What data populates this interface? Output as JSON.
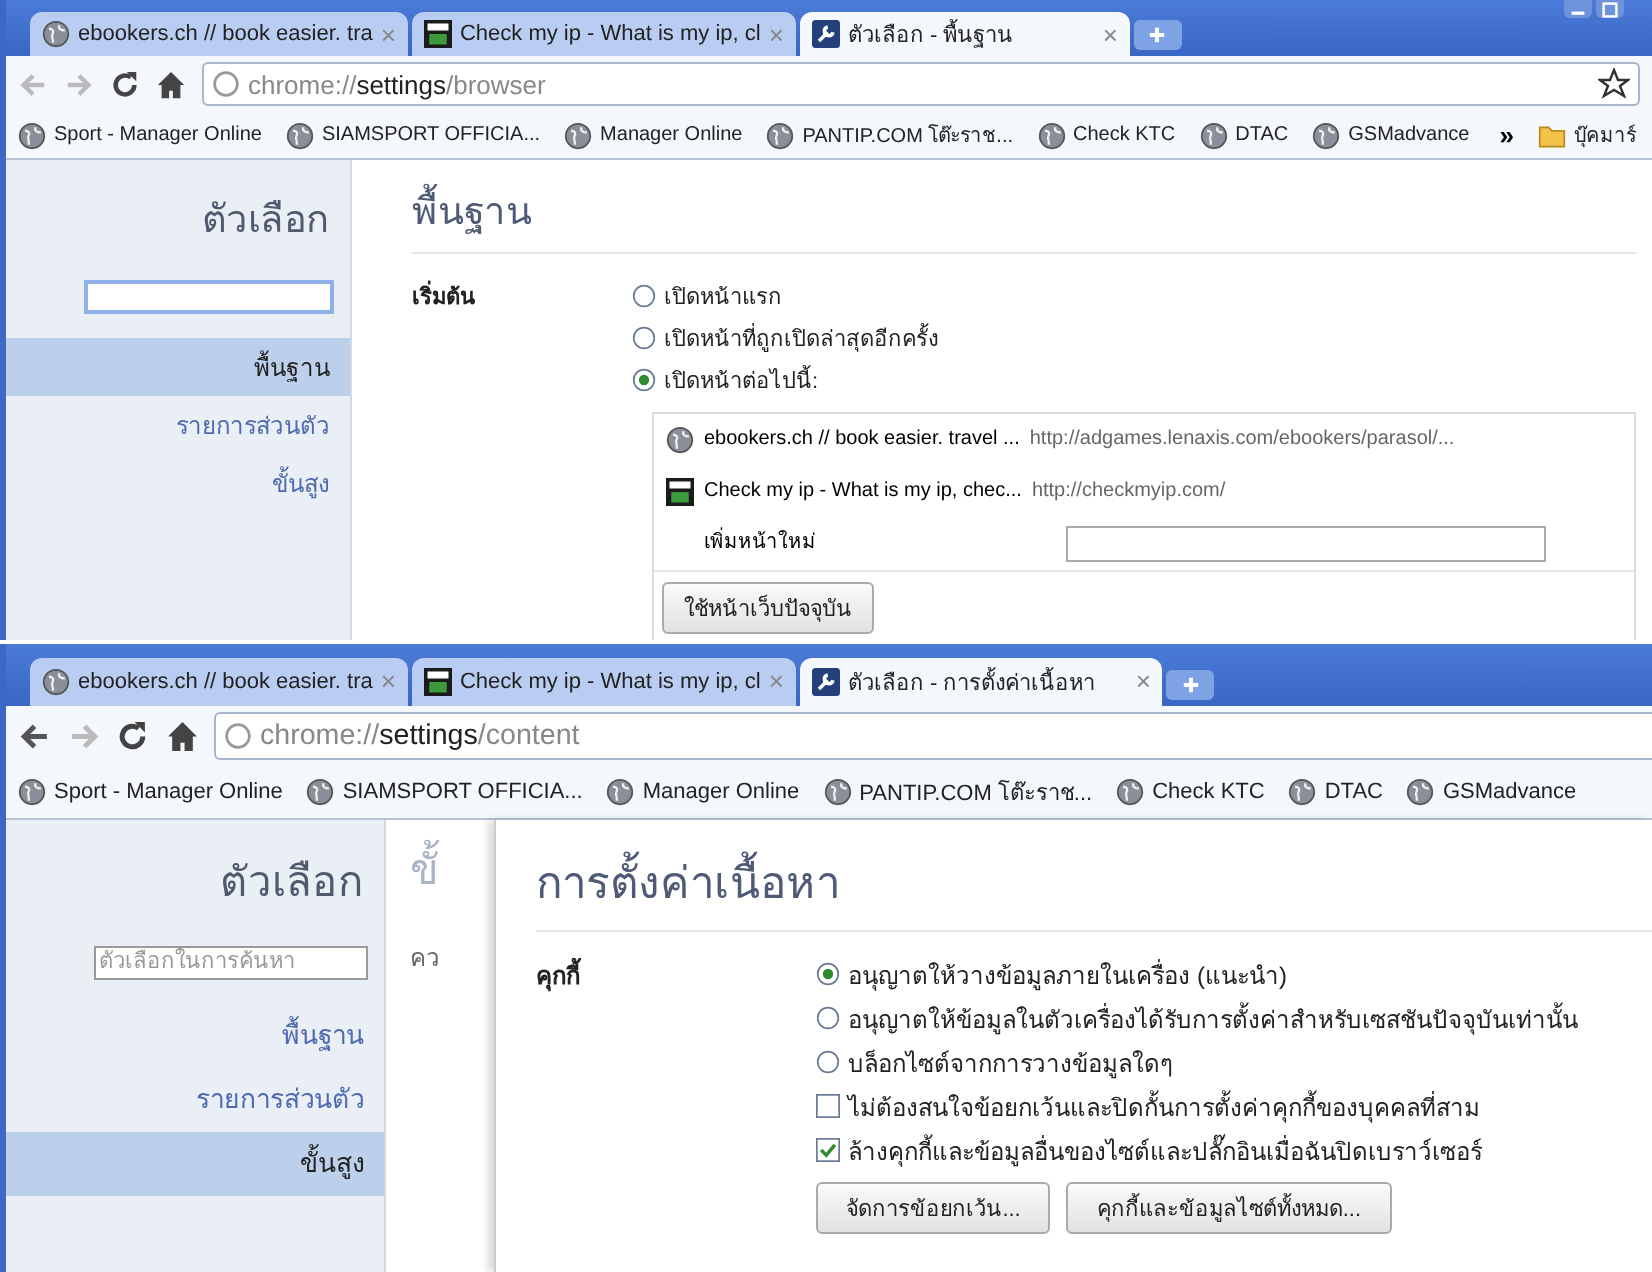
{
  "windows": [
    {
      "tabs": [
        {
          "label": "ebookers.ch // book easier. tra",
          "selected": false,
          "close": "×"
        },
        {
          "label": "Check my ip - What is my ip, cl",
          "selected": false,
          "close": "×"
        },
        {
          "label": "ตัวเลือก - พื้นฐาน",
          "selected": true,
          "close": "×"
        }
      ],
      "address": {
        "prefix": "chrome://",
        "host": "settings",
        "path": "/browser"
      },
      "bookmarks": [
        "Sport - Manager Online",
        "SIAMSPORT OFFICIA...",
        "Manager Online",
        "PANTIP.COM โต๊ะราช...",
        "Check KTC",
        "DTAC",
        "GSMadvance"
      ],
      "bookmarks_overflow": "»",
      "bookmark_folder": "บุ๊คมาร์",
      "sidebar": {
        "title": "ตัวเลือก",
        "search": {
          "focused": true
        },
        "items": [
          {
            "label": "พื้นฐาน",
            "selected": true
          },
          {
            "label": "รายการส่วนตัว",
            "selected": false
          },
          {
            "label": "ขั้นสูง",
            "selected": false
          }
        ]
      },
      "page": {
        "kind": "basics",
        "heading": "พื้นฐาน",
        "section_label": "เริ่มต้น",
        "options": [
          {
            "kind": "radio",
            "label": "เปิดหน้าแรก",
            "selected": false
          },
          {
            "kind": "radio",
            "label": "เปิดหน้าที่ถูกเปิดล่าสุดอีกครั้ง",
            "selected": false
          },
          {
            "kind": "radio",
            "label": "เปิดหน้าต่อไปนี้:",
            "selected": true
          }
        ],
        "startup_pages": [
          {
            "title": "ebookers.ch // book easier. travel ...",
            "url": "http://adgames.lenaxis.com/ebookers/parasol/..."
          },
          {
            "title": "Check my ip - What is my ip, chec...",
            "url": "http://checkmyip.com/"
          }
        ],
        "add_page_label": "เพิ่มหน้าใหม่",
        "use_current_button": "ใช้หน้าเว็บปัจจุบัน"
      }
    },
    {
      "tabs": [
        {
          "label": "ebookers.ch // book easier. tra",
          "selected": false,
          "close": "×"
        },
        {
          "label": "Check my ip - What is my ip, cl",
          "selected": false,
          "close": "×"
        },
        {
          "label": "ตัวเลือก - การตั้งค่าเนื้อหา",
          "selected": true,
          "close": "×"
        }
      ],
      "address": {
        "prefix": "chrome://",
        "host": "settings",
        "path": "/content"
      },
      "bookmarks": [
        "Sport - Manager Online",
        "SIAMSPORT OFFICIA...",
        "Manager Online",
        "PANTIP.COM โต๊ะราช...",
        "Check KTC",
        "DTAC",
        "GSMadvance"
      ],
      "sidebar": {
        "title": "ตัวเลือก",
        "search": {
          "placeholder": "ตัวเลือกในการค้นหา",
          "focused": false
        },
        "items": [
          {
            "label": "พื้นฐาน",
            "selected": false
          },
          {
            "label": "รายการส่วนตัว",
            "selected": false
          },
          {
            "label": "ขั้นสูง",
            "selected": true
          }
        ]
      },
      "page": {
        "kind": "content_overlay",
        "background_heading": "ขั้",
        "background_label": "คว",
        "heading": "การตั้งค่าเนื้อหา",
        "section_label": "คุกกี้",
        "options": [
          {
            "kind": "radio",
            "label": "อนุญาตให้วางข้อมูลภายในเครื่อง (แนะนำ)",
            "selected": true
          },
          {
            "kind": "radio",
            "label": "อนุญาตให้ข้อมูลในตัวเครื่องได้รับการตั้งค่าสำหรับเซสชันปัจจุบันเท่านั้น",
            "selected": false
          },
          {
            "kind": "radio",
            "label": "บล็อกไซต์จากการวางข้อมูลใดๆ",
            "selected": false
          },
          {
            "kind": "checkbox",
            "label": "ไม่ต้องสนใจข้อยกเว้นและปิดกั้นการตั้งค่าคุกกี้ของบุคคลที่สาม",
            "checked": false
          },
          {
            "kind": "checkbox",
            "label": "ล้างคุกกี้และข้อมูลอื่นของไซต์และปลั๊กอินเมื่อฉันปิดเบราว์เซอร์",
            "checked": true
          }
        ],
        "buttons": [
          "จัดการข้อยกเว้น...",
          "คุกกี้และข้อมูลไซต์ทั้งหมด..."
        ]
      }
    }
  ]
}
